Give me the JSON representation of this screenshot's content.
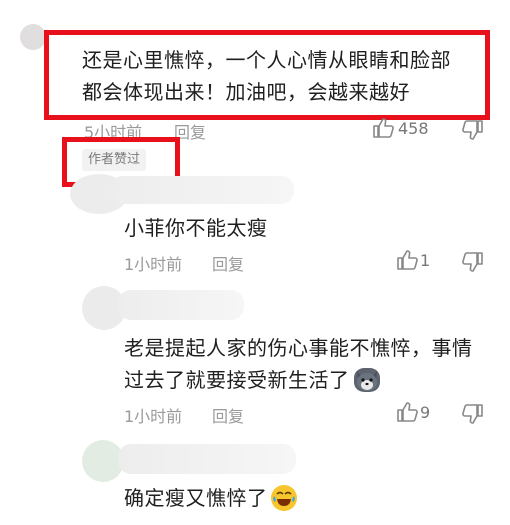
{
  "comments": [
    {
      "text": "还是心里憔悴，一个人心情从眼睛和脸部都会体现出来！加油吧，会越来越好",
      "text_line1": "还是心里憔悴，一个人心情从眼睛和脸部",
      "text_line2": "都会体现出来！加油吧，会越来越好",
      "time": "5小时前",
      "reply_label": "回复",
      "likes": "458",
      "badge": "作者赞过"
    },
    {
      "text": "小菲你不能太瘦",
      "time": "1小时前",
      "reply_label": "回复",
      "likes": "1"
    },
    {
      "text_line1": "老是提起人家的伤心事能不憔悴，事情",
      "text_line2": "过去了就要接受新生活了",
      "emoji": "wolf-emoji",
      "time": "1小时前",
      "reply_label": "回复",
      "likes": "9"
    },
    {
      "text": "确定瘦又憔悴了",
      "emoji": "laughing-emoji"
    }
  ],
  "colors": {
    "highlight": "#e8101a",
    "meta": "#9a9a9a"
  }
}
